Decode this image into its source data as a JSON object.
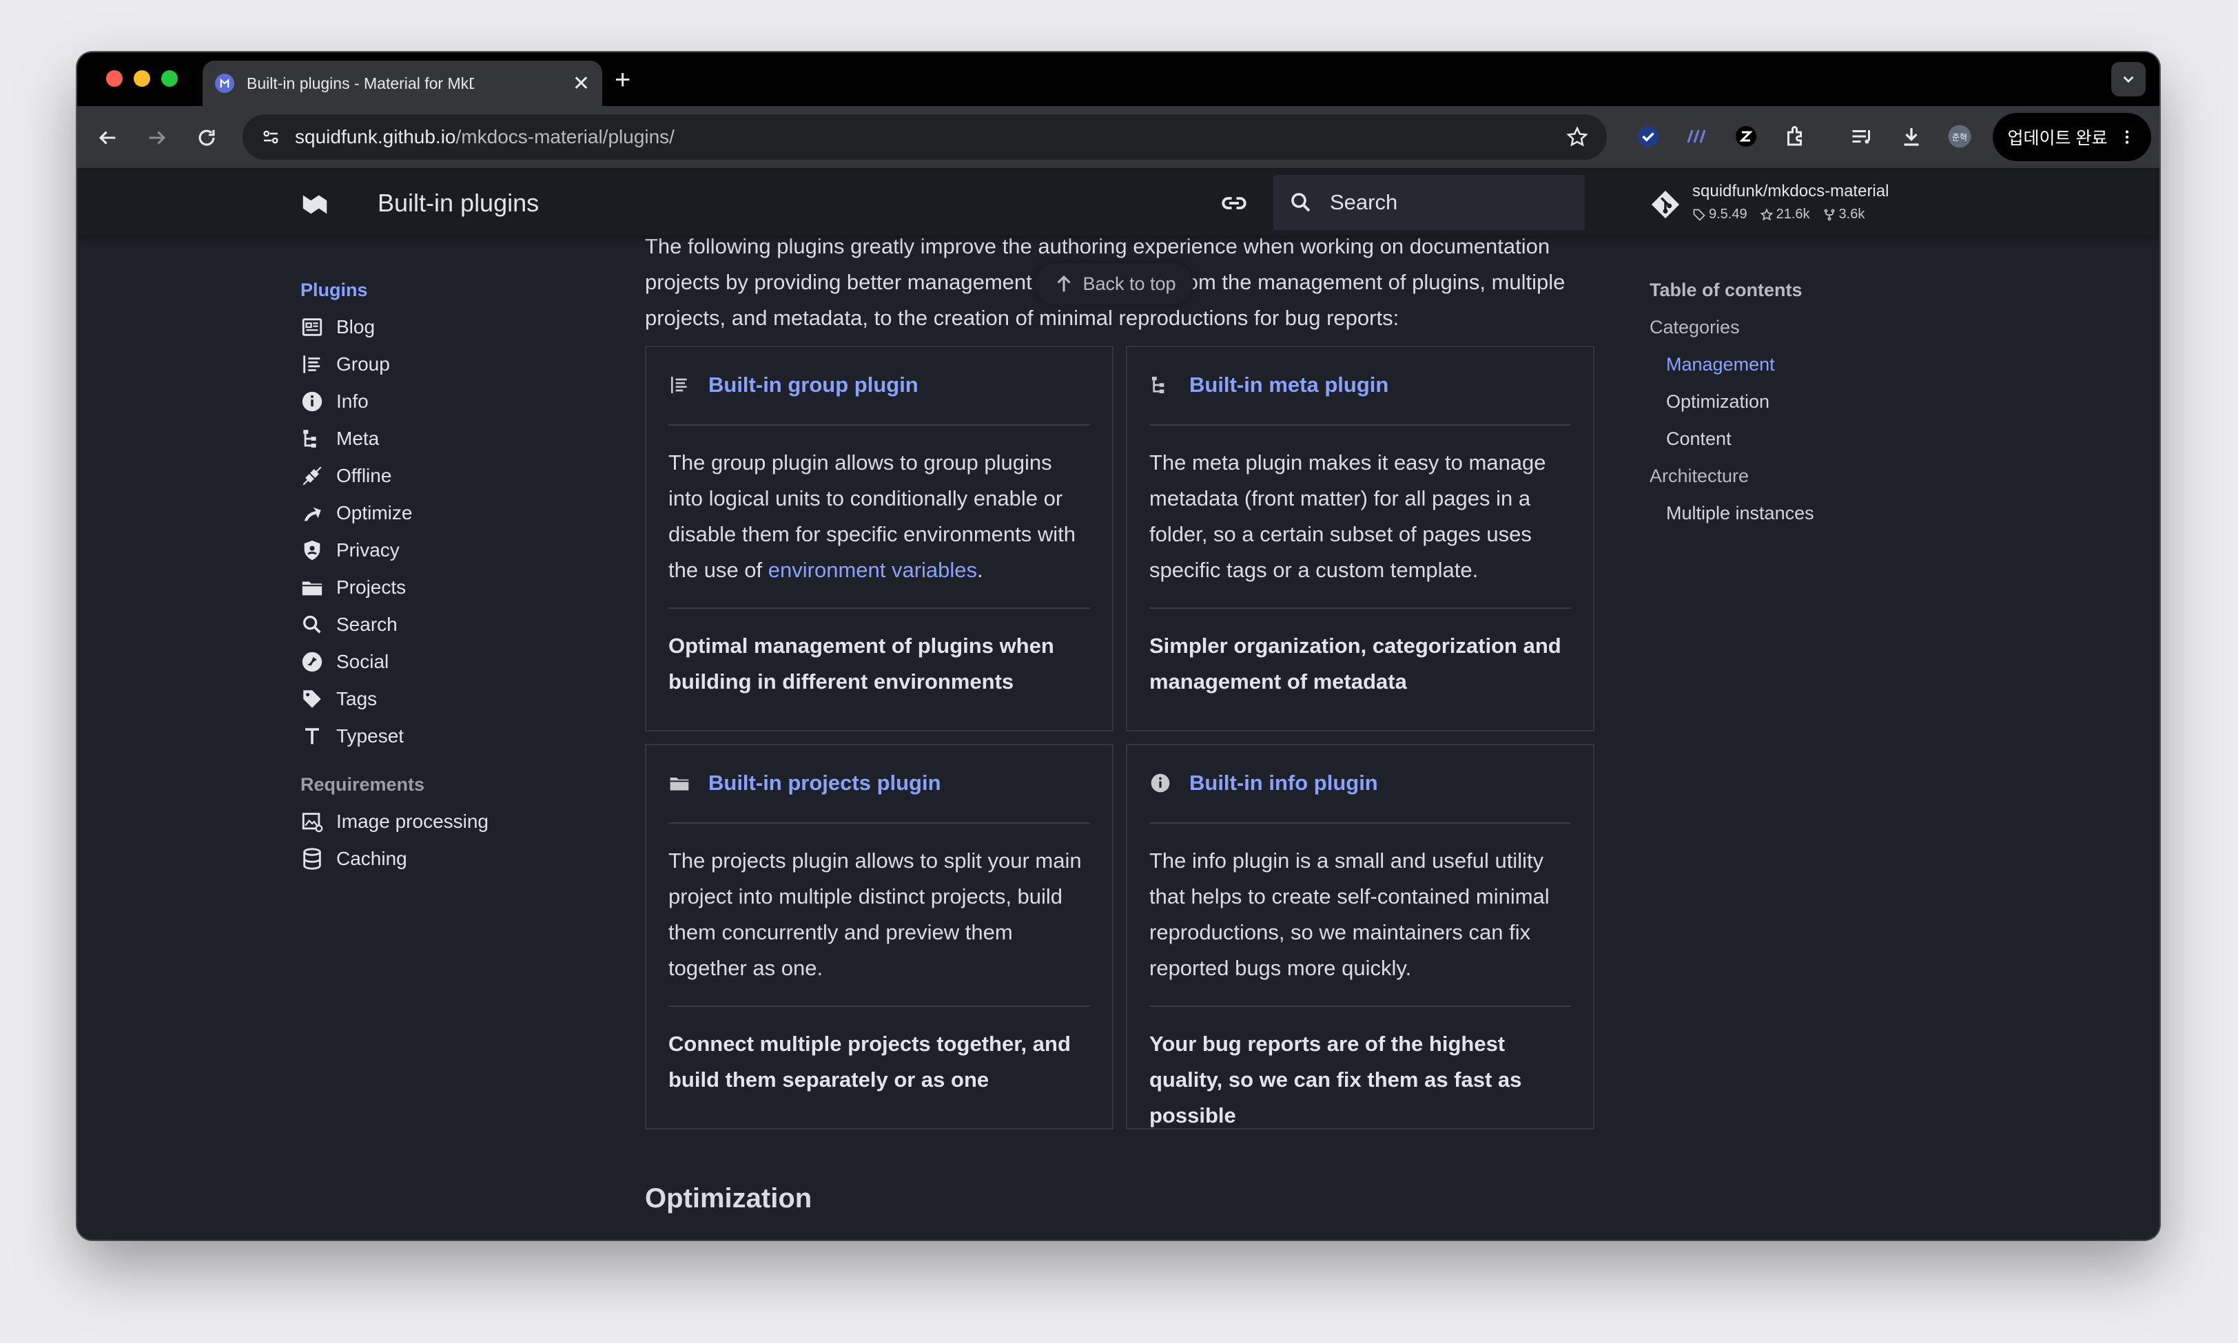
{
  "browser": {
    "tab_title": "Built-in plugins - Material for MkDocs",
    "url_host": "squidfunk.github.io",
    "url_path": "/mkdocs-material/plugins/",
    "update_label": "업데이트 완료",
    "profile_label": "준혁"
  },
  "header": {
    "title": "Built-in plugins",
    "search_placeholder": "Search",
    "repo_name": "squidfunk/mkdocs-material",
    "repo_version": "9.5.49",
    "repo_stars": "21.6k",
    "repo_forks": "3.6k"
  },
  "sidebar": {
    "heading": "Plugins",
    "items": [
      {
        "label": "Blog",
        "icon": "blog-icon"
      },
      {
        "label": "Group",
        "icon": "group-icon"
      },
      {
        "label": "Info",
        "icon": "info-icon"
      },
      {
        "label": "Meta",
        "icon": "meta-icon"
      },
      {
        "label": "Offline",
        "icon": "offline-icon"
      },
      {
        "label": "Optimize",
        "icon": "optimize-icon"
      },
      {
        "label": "Privacy",
        "icon": "privacy-icon"
      },
      {
        "label": "Projects",
        "icon": "folder-icon"
      },
      {
        "label": "Search",
        "icon": "search-icon"
      },
      {
        "label": "Social",
        "icon": "social-icon"
      },
      {
        "label": "Tags",
        "icon": "tag-icon"
      },
      {
        "label": "Typeset",
        "icon": "typeset-icon"
      }
    ],
    "req_heading": "Requirements",
    "req_items": [
      {
        "label": "Image processing",
        "icon": "image-icon"
      },
      {
        "label": "Caching",
        "icon": "database-icon"
      }
    ]
  },
  "content": {
    "intro": "The following plugins greatly improve the authoring experience when working on documentation projects by providing better management for everything from the management of plugins, multiple projects, and metadata, to the creation of minimal reproductions for bug reports:",
    "back_to_top": "Back to top",
    "cards": [
      {
        "title": "Built-in group plugin",
        "desc_before": "The group plugin allows to group plugins into logical units to conditionally enable or disable them for specific environments with the use of ",
        "desc_link": "environment variables",
        "desc_after": ".",
        "tagline": "Optimal management of plugins when building in different environments"
      },
      {
        "title": "Built-in meta plugin",
        "desc_before": "The meta plugin makes it easy to manage metadata (front matter) for all pages in a folder, so a certain subset of pages uses specific tags or a custom template.",
        "desc_link": "",
        "desc_after": "",
        "tagline": "Simpler organization, categorization and management of metadata"
      },
      {
        "title": "Built-in projects plugin",
        "desc_before": "The projects plugin allows to split your main project into multiple distinct projects, build them concurrently and preview them together as one.",
        "desc_link": "",
        "desc_after": "",
        "tagline": "Connect multiple projects together, and build them separately or as one"
      },
      {
        "title": "Built-in info plugin",
        "desc_before": "The info plugin is a small and useful utility that helps to create self-contained minimal reproductions, so we maintainers can fix reported bugs more quickly.",
        "desc_link": "",
        "desc_after": "",
        "tagline": "Your bug reports are of the highest quality, so we can fix them as fast as possible"
      }
    ],
    "next_section": "Optimization"
  },
  "toc": {
    "heading": "Table of contents",
    "items": [
      {
        "label": "Categories",
        "level": 1
      },
      {
        "label": "Management",
        "level": 2,
        "active": true
      },
      {
        "label": "Optimization",
        "level": 2
      },
      {
        "label": "Content",
        "level": 2
      },
      {
        "label": "Architecture",
        "level": 1
      },
      {
        "label": "Multiple instances",
        "level": 2
      }
    ]
  },
  "colors": {
    "accent": "#8aa2ff",
    "background": "#1f2129",
    "header": "#1a1c22"
  }
}
